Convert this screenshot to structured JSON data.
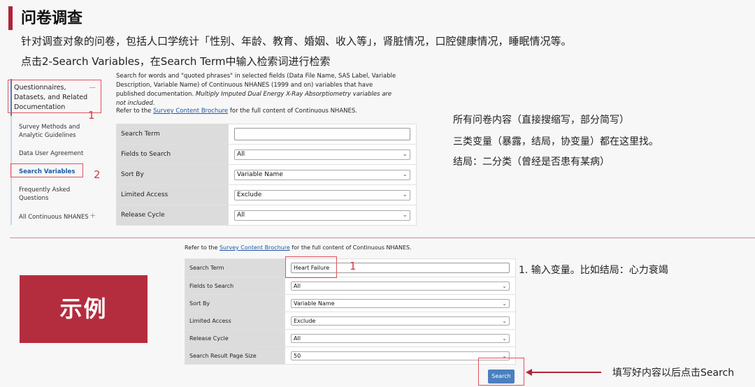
{
  "header": {
    "title": "问卷调查",
    "line1": "针对调查对象的问卷，包括人口学统计「性别、年龄、教育、婚姻、收入等」，肾脏情况，口腔健康情况，睡眠情况等。",
    "line2": "点击2-Search Variables，在Search Term中输入检索词进行检索"
  },
  "sidebar": {
    "header": "Questionnaires, Datasets, and Related Documentation",
    "toggle": "—",
    "items": [
      {
        "label": "Survey Methods and Analytic Guidelines"
      },
      {
        "label": "Data User Agreement"
      },
      {
        "label": "Search Variables"
      },
      {
        "label": "Frequently Asked Questions"
      },
      {
        "label": "All Continuous NHANES"
      }
    ],
    "plus": "+",
    "marker1": "1",
    "marker2": "2"
  },
  "form1": {
    "intro_main": "Search for words and \"quoted phrases\" in selected fields (Data File Name, SAS Label, Variable Description, Variable Name) of Continuous NHANES (1999 and on) variables that have published documentation. ",
    "intro_italic": "Multiply Imputed Dual Energy X-Ray Absorptiometry variables are not included.",
    "refer_prefix": "Refer to the ",
    "refer_link": "Survey Content Brochure",
    "refer_suffix": " for the full content of Continuous NHANES.",
    "rows": [
      {
        "label": "Search Term",
        "value": ""
      },
      {
        "label": "Fields to Search",
        "value": "All"
      },
      {
        "label": "Sort By",
        "value": "Variable Name"
      },
      {
        "label": "Limited Access",
        "value": "Exclude"
      },
      {
        "label": "Release Cycle",
        "value": "All"
      }
    ]
  },
  "notes": {
    "n1": "所有问卷内容（直接搜缩写，部分简写）",
    "n2": "三类变量（暴露，结局，协变量）都在这里找。",
    "n3": "结局：二分类（曾经是否患有某病）"
  },
  "example": {
    "label": "示例",
    "refer_prefix": "Refer to the ",
    "refer_link": "Survey Content Brochure",
    "refer_suffix": " for the full content of Continuous NHANES.",
    "rows": [
      {
        "label": "Search Term",
        "value": "Heart Failure"
      },
      {
        "label": "Fields to Search",
        "value": "All"
      },
      {
        "label": "Sort By",
        "value": "Variable Name"
      },
      {
        "label": "Limited Access",
        "value": "Exclude"
      },
      {
        "label": "Release Cycle",
        "value": "All"
      },
      {
        "label": "Search Result Page Size",
        "value": "50"
      }
    ],
    "marker": "1",
    "step_note": "1. 输入变量。比如结局：心力衰竭",
    "search_button": "Search",
    "search_note": "填写好内容以后点击Search"
  },
  "colors": {
    "accent": "#b0243a",
    "link": "#1d56a7",
    "button": "#4a7fc0"
  },
  "icons": {
    "chevron": "chevron-down-icon",
    "plus": "plus-icon",
    "minus": "minus-icon",
    "arrow": "arrow-left-icon"
  }
}
